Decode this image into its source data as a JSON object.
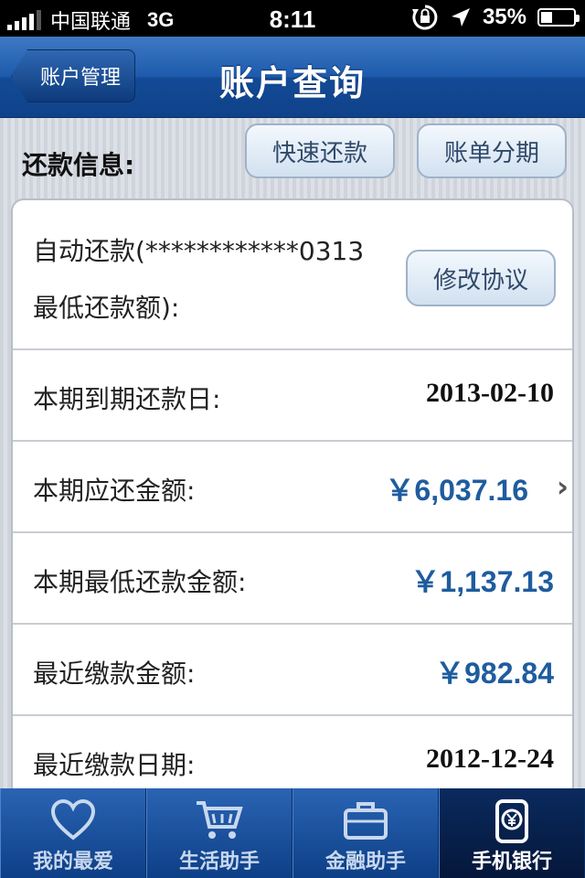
{
  "status_bar": {
    "carrier": "中国联通",
    "network": "3G",
    "time": "8:11",
    "battery": "35%",
    "battery_level": 0.35
  },
  "nav": {
    "back_label": "账户管理",
    "title": "账户查询"
  },
  "repayment": {
    "section_label": "还款信息:",
    "quick_repay_label": "快速还款",
    "installment_label": "账单分期",
    "auto_repay_line1": "自动还款(************0313",
    "auto_repay_line2": "最低还款额):",
    "modify_label": "修改协议",
    "rows": [
      {
        "label": "本期到期还款日:",
        "value": "2013-02-10"
      },
      {
        "label": "本期应还金额:",
        "value": "￥6,037.16"
      },
      {
        "label": "本期最低还款金额:",
        "value": "￥1,137.13"
      },
      {
        "label": "最近缴款金额:",
        "value": "￥982.84"
      },
      {
        "label": "最近缴款日期:",
        "value": "2012-12-24"
      }
    ]
  },
  "tabs": [
    {
      "label": "我的最爱",
      "icon": "heart-icon"
    },
    {
      "label": "生活助手",
      "icon": "cart-icon"
    },
    {
      "label": "金融助手",
      "icon": "briefcase-icon"
    },
    {
      "label": "手机银行",
      "icon": "phone-yuan-icon"
    }
  ],
  "colors": {
    "nav_blue": "#1d5aac",
    "money_blue": "#1f5c9e",
    "tab_active": "#05173a"
  }
}
